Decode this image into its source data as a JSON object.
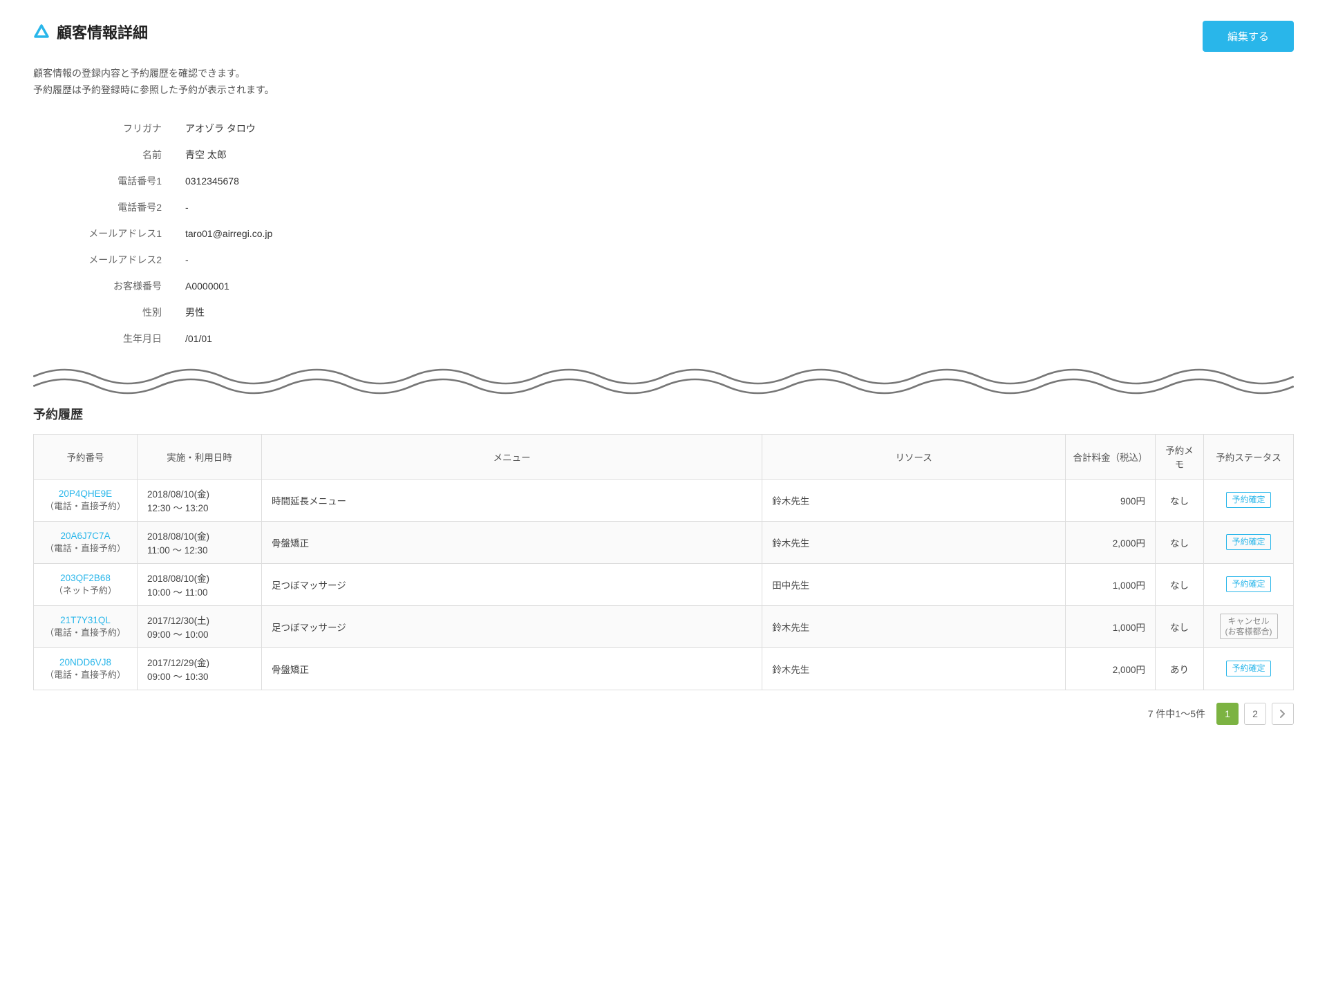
{
  "header": {
    "title": "顧客情報詳細",
    "edit_button": "編集する"
  },
  "description": {
    "line1": "顧客情報の登録内容と予約履歴を確認できます。",
    "line2": "予約履歴は予約登録時に参照した予約が表示されます。"
  },
  "details": {
    "furigana_label": "フリガナ",
    "furigana_value": "アオゾラ タロウ",
    "name_label": "名前",
    "name_value": "青空 太郎",
    "phone1_label": "電話番号1",
    "phone1_value": "0312345678",
    "phone2_label": "電話番号2",
    "phone2_value": "-",
    "email1_label": "メールアドレス1",
    "email1_value": "taro01@airregi.co.jp",
    "email2_label": "メールアドレス2",
    "email2_value": "-",
    "customer_no_label": "お客様番号",
    "customer_no_value": "A0000001",
    "gender_label": "性別",
    "gender_value": "男性",
    "birthdate_label": "生年月日",
    "birthdate_value": "/01/01"
  },
  "history": {
    "title": "予約履歴",
    "columns": {
      "number": "予約番号",
      "datetime": "実施・利用日時",
      "menu": "メニュー",
      "resource": "リソース",
      "price": "合計料金（税込）",
      "memo": "予約メモ",
      "status": "予約ステータス"
    },
    "rows": [
      {
        "number": "20P4QHE9E",
        "channel": "（電話・直接予約）",
        "date": "2018/08/10(金)",
        "time": "12:30 〜 13:20",
        "menu": "時間延長メニュー",
        "resource": "鈴木先生",
        "price": "900円",
        "memo": "なし",
        "status": "予約確定",
        "status_type": "confirmed"
      },
      {
        "number": "20A6J7C7A",
        "channel": "（電話・直接予約）",
        "date": "2018/08/10(金)",
        "time": "11:00 〜 12:30",
        "menu": "骨盤矯正",
        "resource": "鈴木先生",
        "price": "2,000円",
        "memo": "なし",
        "status": "予約確定",
        "status_type": "confirmed"
      },
      {
        "number": "203QF2B68",
        "channel": "（ネット予約）",
        "date": "2018/08/10(金)",
        "time": "10:00 〜 11:00",
        "menu": "足つぼマッサージ",
        "resource": "田中先生",
        "price": "1,000円",
        "memo": "なし",
        "status": "予約確定",
        "status_type": "confirmed"
      },
      {
        "number": "21T7Y31QL",
        "channel": "（電話・直接予約）",
        "date": "2017/12/30(土)",
        "time": "09:00 〜 10:00",
        "menu": "足つぼマッサージ",
        "resource": "鈴木先生",
        "price": "1,000円",
        "memo": "なし",
        "status": "キャンセル\n(お客様都合)",
        "status_type": "cancelled"
      },
      {
        "number": "20NDD6VJ8",
        "channel": "（電話・直接予約）",
        "date": "2017/12/29(金)",
        "time": "09:00 〜 10:30",
        "menu": "骨盤矯正",
        "resource": "鈴木先生",
        "price": "2,000円",
        "memo": "あり",
        "status": "予約確定",
        "status_type": "confirmed"
      }
    ]
  },
  "pagination": {
    "info": "7 件中1〜5件",
    "pages": [
      "1",
      "2"
    ],
    "active": 0
  }
}
